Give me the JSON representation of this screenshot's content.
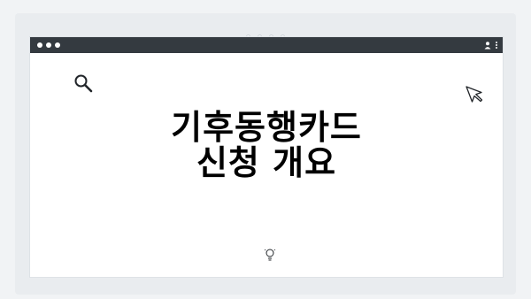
{
  "window": {
    "title_dots": 3,
    "top_dots": 4
  },
  "headline": {
    "line1": "기후동행카드",
    "line2": "신청 개요"
  },
  "icons": {
    "search": "search-icon",
    "cursor": "cursor-icon",
    "user": "user-icon",
    "menu": "kebab-menu-icon",
    "bulb": "lightbulb-icon"
  },
  "colors": {
    "titlebar": "#343a40",
    "background": "#f1f3f5",
    "text": "#000000"
  }
}
